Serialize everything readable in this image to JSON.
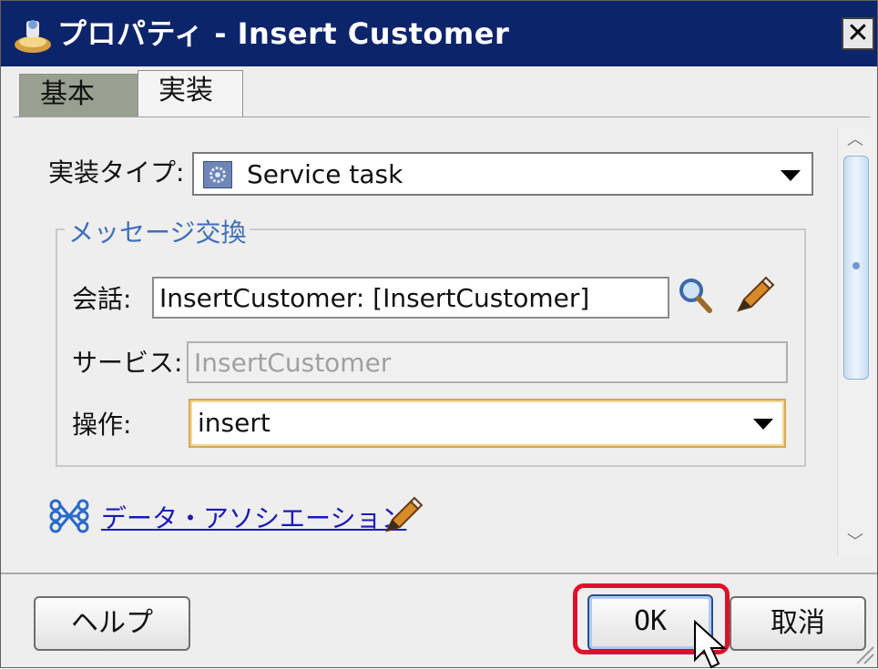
{
  "window": {
    "title": "プロパティ - Insert Customer",
    "close_glyph": "✕"
  },
  "tabs": [
    {
      "label": "基本",
      "selected": false
    },
    {
      "label": "実装",
      "selected": true
    }
  ],
  "form": {
    "impl_type_label": "実装タイプ:",
    "impl_type_value": "Service task",
    "message_exchange_legend": "メッセージ交換",
    "conversation_label": "会話:",
    "conversation_value": "InsertCustomer: [InsertCustomer]",
    "service_label": "サービス:",
    "service_value": "InsertCustomer",
    "operation_label": "操作:",
    "operation_value": "insert",
    "data_association_link": "データ・アソシエーション"
  },
  "buttons": {
    "help": "ヘルプ",
    "ok": "OK",
    "cancel": "取消"
  },
  "colors": {
    "titlebar": "#0c246a",
    "highlight": "#e0102a",
    "legend": "#3e6fb8",
    "link": "#1a1ab8"
  },
  "icons": {
    "title": "bpm-process-icon",
    "service_task": "gear-icon",
    "search": "magnifier-icon",
    "edit": "pencil-icon",
    "data_association": "data-mapping-icon"
  }
}
